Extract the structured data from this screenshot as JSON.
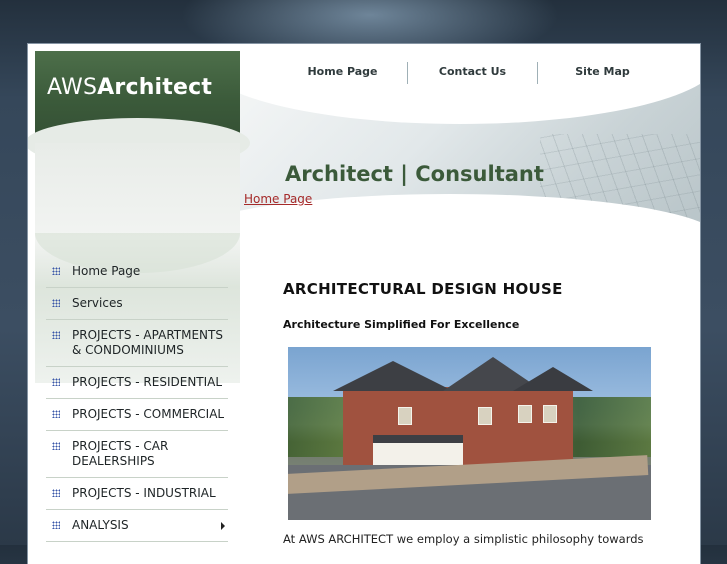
{
  "brand": {
    "prefix": "AWS",
    "name": "Architect"
  },
  "top_nav": [
    {
      "label": "Home Page"
    },
    {
      "label": "Contact Us"
    },
    {
      "label": "Site Map"
    }
  ],
  "tagline": "Architect | Consultant",
  "breadcrumb": "Home Page",
  "side_menu": [
    {
      "label": "Home Page",
      "submenu": false
    },
    {
      "label": "Services",
      "submenu": false
    },
    {
      "label": "PROJECTS - APARTMENTS & CONDOMINIUMS",
      "submenu": false
    },
    {
      "label": "PROJECTS - RESIDENTIAL",
      "submenu": false
    },
    {
      "label": "PROJECTS - COMMERCIAL",
      "submenu": false
    },
    {
      "label": "PROJECTS - CAR DEALERSHIPS",
      "submenu": false
    },
    {
      "label": "PROJECTS - INDUSTRIAL",
      "submenu": false
    },
    {
      "label": "ANALYSIS",
      "submenu": true
    }
  ],
  "main": {
    "heading": "ARCHITECTURAL DESIGN HOUSE",
    "subheading": "Architecture Simplified For Excellence",
    "image_subject": "rendering of brick townhouse building",
    "intro": "At AWS ARCHITECT we employ a simplistic philosophy towards"
  }
}
